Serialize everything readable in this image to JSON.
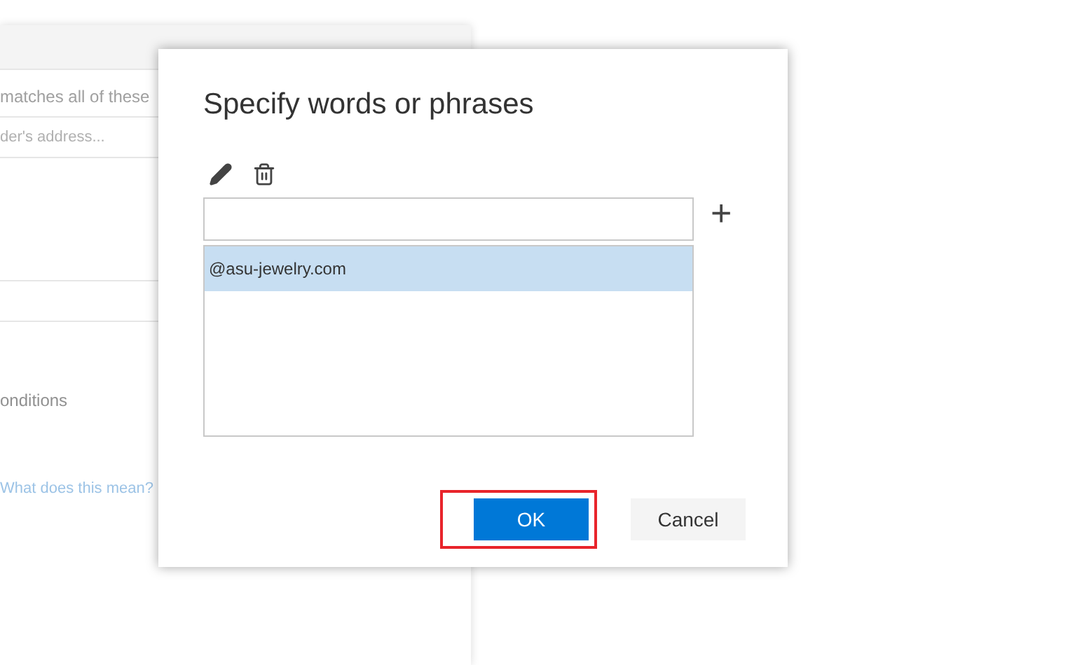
{
  "background": {
    "condition_text": "matches all of these",
    "address_placeholder": "der's address...",
    "conditions_text": "onditions",
    "help_link": "What does this mean?"
  },
  "dialog": {
    "title": "Specify words or phrases",
    "toolbar": [
      {
        "kind": "edit"
      },
      {
        "kind": "delete"
      }
    ],
    "add_button": "+",
    "items": [
      {
        "text": "@asu-jewelry.com",
        "selected": true
      }
    ],
    "buttons": [
      {
        "label": "OK",
        "kind": "primary",
        "highlighted": true
      },
      {
        "label": "Cancel",
        "kind": "secondary",
        "highlighted": false
      }
    ]
  }
}
